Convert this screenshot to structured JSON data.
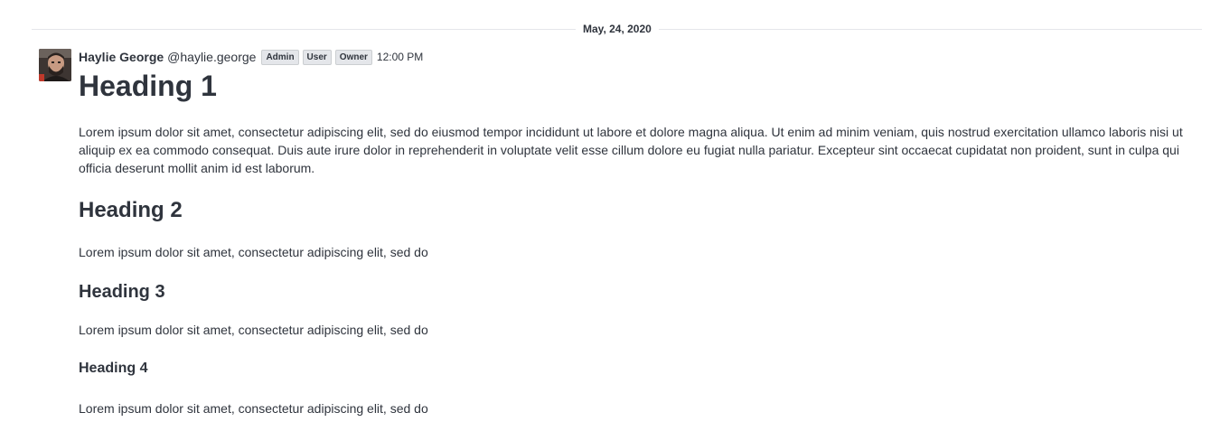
{
  "date_divider": "May, 24, 2020",
  "message": {
    "author_name": "Haylie George",
    "author_username": "@haylie.george",
    "roles": [
      "Admin",
      "User",
      "Owner"
    ],
    "time": "12:00 PM",
    "heading1": "Heading 1",
    "paragraph1": "Lorem ipsum dolor sit amet, consectetur adipiscing elit, sed do eiusmod tempor incididunt ut labore et dolore magna aliqua. Ut enim ad minim veniam, quis nostrud exercitation ullamco laboris nisi ut aliquip ex ea commodo consequat. Duis aute irure dolor in reprehenderit in voluptate velit esse cillum dolore eu fugiat nulla pariatur. Excepteur sint occaecat cupidatat non proident, sunt in culpa qui officia deserunt mollit anim id est laborum.",
    "heading2": "Heading 2",
    "paragraph2": "Lorem ipsum dolor sit amet, consectetur adipiscing elit, sed do",
    "heading3": "Heading 3",
    "paragraph3": "Lorem ipsum dolor sit amet, consectetur adipiscing elit, sed do",
    "heading4": "Heading 4",
    "paragraph4": "Lorem ipsum dolor sit amet, consectetur adipiscing elit, sed do"
  },
  "colors": {
    "text": "#2f343d",
    "divider": "#e4e6ea",
    "badge_bg": "#e4e6ea",
    "background": "#ffffff"
  },
  "icons": {
    "avatar": "user-avatar-photo"
  }
}
